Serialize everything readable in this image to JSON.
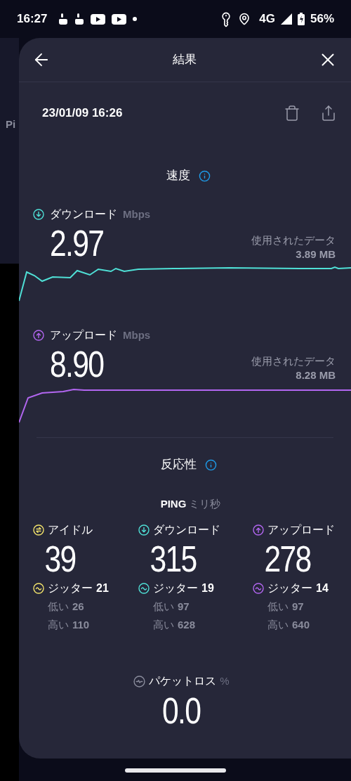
{
  "status_bar": {
    "time": "16:27",
    "network": "4G",
    "battery": "56%"
  },
  "background": {
    "text": "Pi"
  },
  "header": {
    "title": "結果"
  },
  "result": {
    "timestamp": "23/01/09 16:26"
  },
  "speed": {
    "title": "速度",
    "tests": [
      {
        "kind": "download",
        "label": "ダウンロード",
        "unit": "Mbps",
        "value": "2.97",
        "data_label": "使用されたデータ",
        "data_value": "3.89 MB",
        "color": "#4fe0d6"
      },
      {
        "kind": "upload",
        "label": "アップロード",
        "unit": "Mbps",
        "value": "8.90",
        "data_label": "使用されたデータ",
        "data_value": "8.28 MB",
        "color": "#b266f0"
      }
    ]
  },
  "responsiveness": {
    "title": "反応性",
    "ping_label": "PING",
    "ping_unit": "ミリ秒",
    "columns": [
      {
        "kind": "idle",
        "label": "アイドル",
        "value": "39",
        "jitter_label": "ジッター",
        "jitter": "21",
        "low_label": "低い",
        "low": "26",
        "high_label": "高い",
        "high": "110",
        "color": "#f2e36b"
      },
      {
        "kind": "download",
        "label": "ダウンロード",
        "value": "315",
        "jitter_label": "ジッター",
        "jitter": "19",
        "low_label": "低い",
        "low": "97",
        "high_label": "高い",
        "high": "628",
        "color": "#4fe0d6"
      },
      {
        "kind": "upload",
        "label": "アップロード",
        "value": "278",
        "jitter_label": "ジッター",
        "jitter": "14",
        "low_label": "低い",
        "low": "97",
        "high_label": "高い",
        "high": "640",
        "color": "#b266f0"
      }
    ]
  },
  "packet_loss": {
    "label": "パケットロス",
    "unit": "%",
    "value": "0.0"
  }
}
